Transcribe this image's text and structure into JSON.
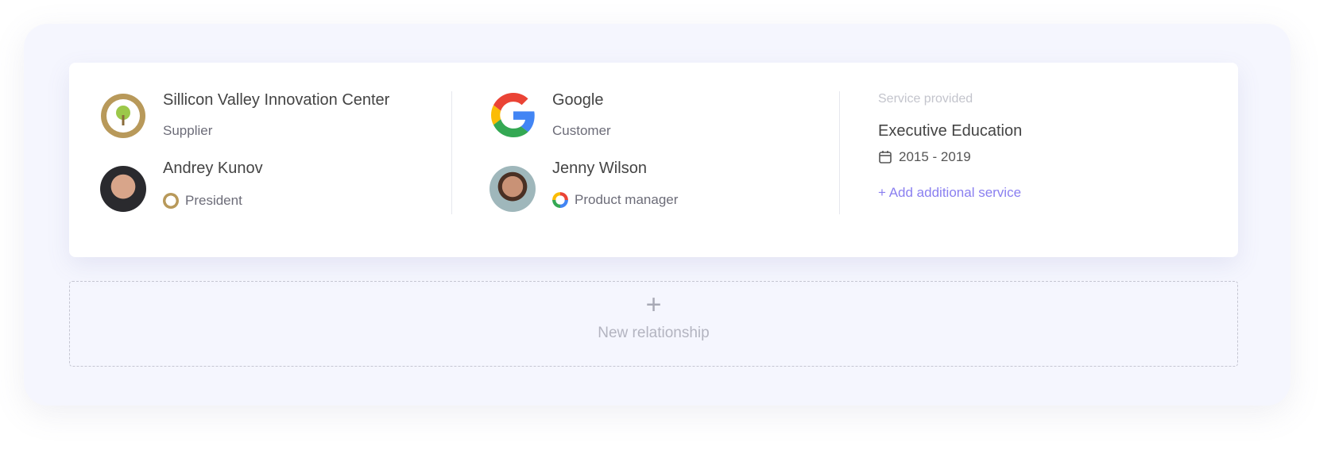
{
  "supplier": {
    "name": "Sillicon Valley Innovation Center",
    "role": "Supplier",
    "logo_icon": "svic-logo",
    "contact": {
      "name": "Andrey Kunov",
      "title": "President"
    }
  },
  "customer": {
    "name": "Google",
    "role": "Customer",
    "logo_icon": "google-logo",
    "contact": {
      "name": "Jenny Wilson",
      "title": "Product manager"
    }
  },
  "service": {
    "label": "Service provided",
    "name": "Executive Education",
    "period": "2015 - 2019",
    "add_label": "+ Add additional service"
  },
  "new_relationship": {
    "icon": "+",
    "label": "New relationship"
  },
  "colors": {
    "accent": "#8a7ff0",
    "panel": "#f5f6fe"
  }
}
